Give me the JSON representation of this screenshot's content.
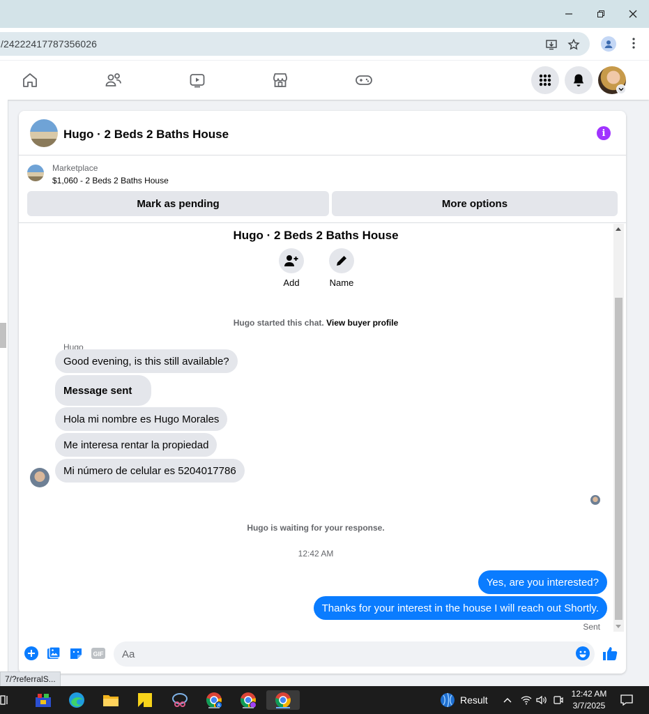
{
  "browser": {
    "url": "/24222417787356026",
    "status_link": "7/?referralS..."
  },
  "conversation": {
    "header_title": "Hugo · 2 Beds 2 Baths House",
    "marketplace_label": "Marketplace",
    "listing": "$1,060 - 2 Beds 2 Baths House",
    "mark_pending_label": "Mark as pending",
    "more_options_label": "More options",
    "chat_title": "Hugo · 2 Beds 2 Baths House",
    "add_label": "Add",
    "name_label": "Name",
    "started_text": "Hugo started this chat.",
    "view_profile_label": "View buyer profile",
    "sender_name": "Hugo",
    "incoming": [
      "Good evening, is this still available?",
      "Message sent",
      "Hola mi nombre es Hugo Morales",
      "Me interesa rentar la propiedad",
      "Mi número de celular es 5204017786"
    ],
    "waiting_text": "Hugo is waiting for your response.",
    "timestamp": "12:42 AM",
    "outgoing": [
      "Yes, are you interested?",
      "Thanks for your interest in the house I will reach out Shortly."
    ],
    "sent_label": "Sent",
    "composer_placeholder": "Aa"
  },
  "taskbar": {
    "weather_label": "Result",
    "time": "12:42 AM",
    "date": "3/7/2025"
  },
  "colors": {
    "accent": "#0a7cff",
    "info": "#a033ff"
  }
}
